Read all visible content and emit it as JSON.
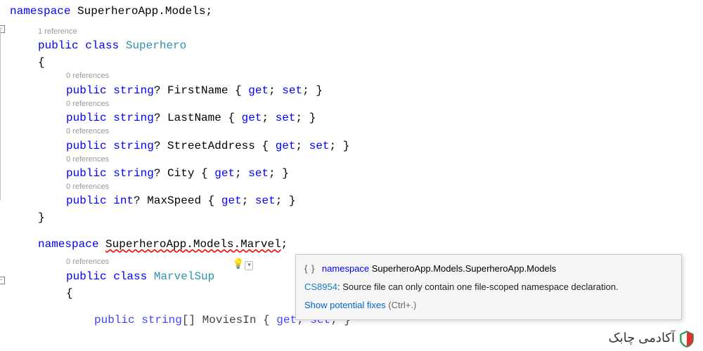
{
  "code": {
    "ns1": {
      "kw": "namespace",
      "name": "SuperheroApp.Models",
      "semi": ";"
    },
    "class1": {
      "codelens": "1 reference",
      "access": "public",
      "kw": "class",
      "name": "Superhero",
      "open": "{",
      "close": "}"
    },
    "props": [
      {
        "codelens": "0 references",
        "access": "public",
        "type": "string",
        "nullable": "?",
        "name": "FirstName",
        "get": "get",
        "set": "set"
      },
      {
        "codelens": "0 references",
        "access": "public",
        "type": "string",
        "nullable": "?",
        "name": "LastName",
        "get": "get",
        "set": "set"
      },
      {
        "codelens": "0 references",
        "access": "public",
        "type": "string",
        "nullable": "?",
        "name": "StreetAddress",
        "get": "get",
        "set": "set"
      },
      {
        "codelens": "0 references",
        "access": "public",
        "type": "string",
        "nullable": "?",
        "name": "City",
        "get": "get",
        "set": "set"
      },
      {
        "codelens": "0 references",
        "access": "public",
        "type": "int",
        "nullable": "?",
        "name": "MaxSpeed",
        "get": "get",
        "set": "set"
      }
    ],
    "ns2": {
      "kw": "namespace",
      "name": "SuperheroApp.Models.Marvel",
      "semi": ";"
    },
    "class2": {
      "codelens": "0 references",
      "access": "public",
      "kw": "class",
      "name_part": "MarvelSup",
      "open": "{",
      "last_partial_pre": "public string[] MoviesIn { ",
      "last_get": "get",
      "last_mid": "; ",
      "last_set": "set",
      "last_post": "; }"
    }
  },
  "tooltip": {
    "braces_icon": "{ }",
    "ns_kw": "namespace",
    "ns_full": " SuperheroApp.Models.SuperheroApp.Models",
    "err_code": "CS8954",
    "err_text": ": Source file can only contain one file-scoped namespace declaration.",
    "fix_link": "Show potential fixes",
    "shortcut": " (Ctrl+.)"
  },
  "watermark": {
    "text": "آکادمی چابک"
  }
}
